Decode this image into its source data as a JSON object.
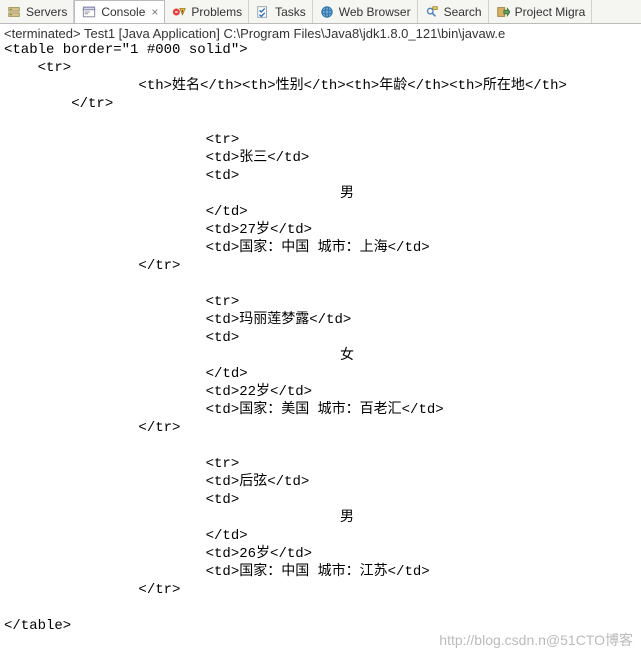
{
  "tabs": [
    {
      "label": "Servers"
    },
    {
      "label": "Console",
      "active": true,
      "closable": true
    },
    {
      "label": "Problems"
    },
    {
      "label": "Tasks"
    },
    {
      "label": "Web Browser"
    },
    {
      "label": "Search"
    },
    {
      "label": "Project Migra"
    }
  ],
  "status_line": "<terminated> Test1 [Java Application] C:\\Program Files\\Java8\\jdk1.8.0_121\\bin\\javaw.e",
  "console_lines": [
    "<table border=\"1 #000 solid\">",
    "    <tr>",
    "                <th>姓名</th><th>性别</th><th>年龄</th><th>所在地</th>",
    "        </tr>",
    "",
    "                        <tr>",
    "                        <td>张三</td>",
    "                        <td>",
    "                                        男",
    "                        </td>",
    "                        <td>27岁</td>",
    "                        <td>国家：中国 城市：上海</td>",
    "                </tr>",
    "",
    "                        <tr>",
    "                        <td>玛丽莲梦露</td>",
    "                        <td>",
    "                                        女",
    "                        </td>",
    "                        <td>22岁</td>",
    "                        <td>国家：美国 城市：百老汇</td>",
    "                </tr>",
    "",
    "                        <tr>",
    "                        <td>后弦</td>",
    "                        <td>",
    "                                        男",
    "                        </td>",
    "                        <td>26岁</td>",
    "                        <td>国家：中国 城市：江苏</td>",
    "                </tr>",
    "",
    "</table>"
  ],
  "watermark": "http://blog.csdn.n@51CTO博客"
}
